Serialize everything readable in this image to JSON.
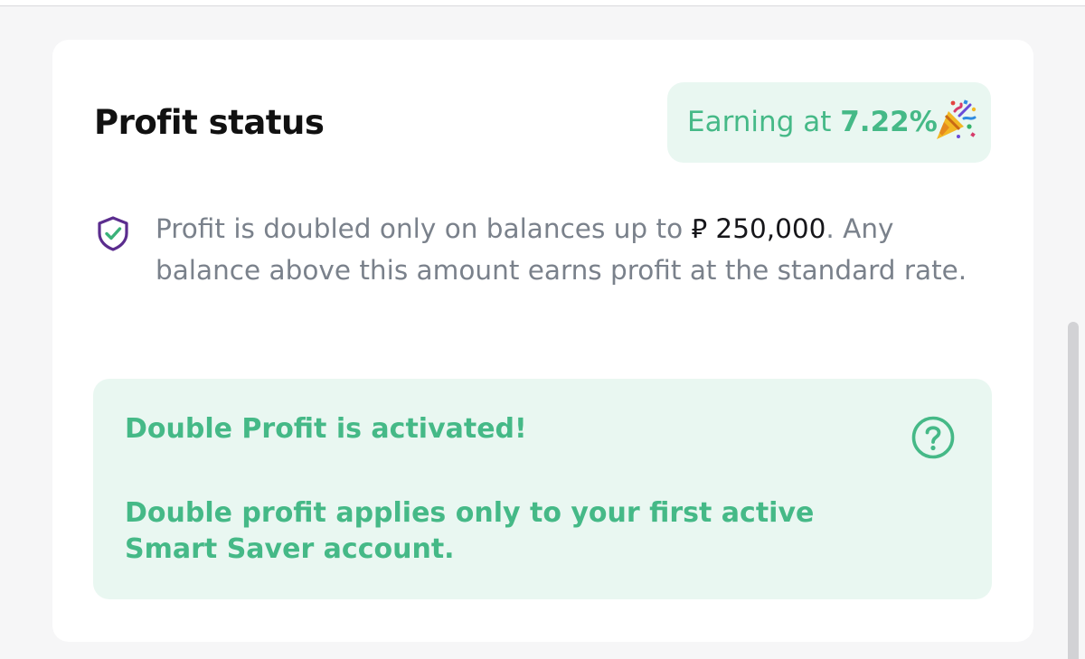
{
  "card": {
    "title": "Profit status",
    "rate_badge": {
      "prefix": "Earning at ",
      "rate": "7.22%",
      "icon": "party-popper-icon",
      "color": "#45b987",
      "background": "#e9f7f1"
    },
    "info": {
      "icon": "shield-check-icon",
      "text_before": "Profit is doubled only on balances up to ",
      "currency_symbol": "⃁",
      "amount": "250,000",
      "text_after": ". Any balance above this amount earns profit at the standard rate."
    },
    "notice": {
      "title": "Double Profit is activated!",
      "help_icon": "help-circle-icon",
      "body": "Double profit applies only to your first active Smart Saver account."
    }
  },
  "colors": {
    "accent_green": "#45b987",
    "notice_background": "#e9f7f1",
    "shield_purple": "#5b2d8e",
    "muted_text": "#7a818b"
  }
}
